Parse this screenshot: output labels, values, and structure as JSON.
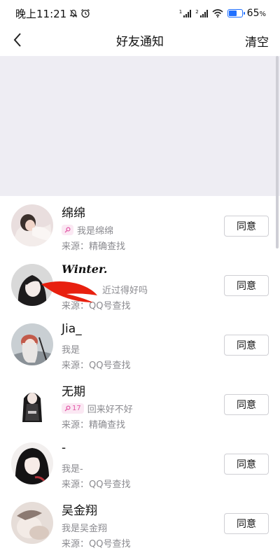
{
  "status_bar": {
    "time": "晚上11:21",
    "battery": "65",
    "battery_unit": "%",
    "battery_level": 0.65,
    "icons": [
      "mute-bell-icon",
      "alarm-icon",
      "signal-icon",
      "signal-icon",
      "wifi-icon",
      "battery-icon"
    ]
  },
  "header": {
    "title": "好友通知",
    "clear_label": "清空",
    "back_icon": "chevron-left-icon"
  },
  "requests": [
    {
      "name": "绵绵",
      "badge": "",
      "message": "我是绵绵",
      "source": "来源：精确查找",
      "agree_label": "同意"
    },
    {
      "name": "Winter.",
      "badge": "",
      "message": "近过得好吗",
      "source": "来源：QQ号查找",
      "agree_label": "同意"
    },
    {
      "name": "Jia_",
      "badge": "",
      "message": "我是",
      "source": "来源：QQ号查找",
      "agree_label": "同意"
    },
    {
      "name": "无期",
      "badge": "17",
      "message": "回来好不好",
      "source": "来源：精确查找",
      "agree_label": "同意"
    },
    {
      "name": "-",
      "badge": "",
      "message": "我是-",
      "source": "来源：QQ号查找",
      "agree_label": "同意"
    },
    {
      "name": "吴金翔",
      "badge": "",
      "message": "我是吴金翔",
      "source": "来源：QQ号查找",
      "agree_label": "同意"
    }
  ],
  "colors": {
    "accent_blue": "#1f6fff",
    "badge_pink": "#e25aa8",
    "scribble_red": "#e8200f",
    "blank_area": "#eeedf3"
  }
}
